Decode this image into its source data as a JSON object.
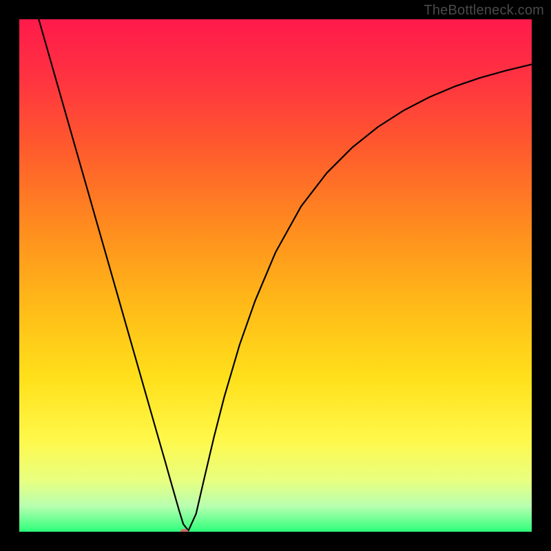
{
  "watermark": "TheBottleneck.com",
  "chart_data": {
    "type": "line",
    "title": "",
    "xlabel": "",
    "ylabel": "",
    "xlim": [
      0,
      100
    ],
    "ylim": [
      0,
      100
    ],
    "grid": false,
    "legend": false,
    "background_gradient_stops": [
      {
        "offset": 0.0,
        "color": "#ff1a4b"
      },
      {
        "offset": 0.12,
        "color": "#ff3440"
      },
      {
        "offset": 0.25,
        "color": "#ff5a2d"
      },
      {
        "offset": 0.4,
        "color": "#ff8a1f"
      },
      {
        "offset": 0.55,
        "color": "#ffb818"
      },
      {
        "offset": 0.7,
        "color": "#ffe01a"
      },
      {
        "offset": 0.82,
        "color": "#fff84a"
      },
      {
        "offset": 0.9,
        "color": "#e8ff80"
      },
      {
        "offset": 0.95,
        "color": "#b8ffb0"
      },
      {
        "offset": 1.0,
        "color": "#2dff7a"
      }
    ],
    "series": [
      {
        "name": "bottleneck-curve",
        "color": "#000000",
        "stroke_width": 2.2,
        "x": [
          3.8,
          5,
          7,
          9,
          11,
          13,
          15,
          17,
          19,
          21,
          23,
          25,
          27,
          28.5,
          29.2,
          29.8,
          30.2,
          30.6,
          31.2,
          32,
          33,
          34.5,
          36,
          38,
          40,
          43,
          46,
          50,
          55,
          60,
          65,
          70,
          75,
          80,
          85,
          90,
          95,
          100
        ],
        "y": [
          100,
          95.8,
          88.8,
          81.8,
          74.8,
          67.8,
          60.8,
          53.8,
          46.8,
          39.8,
          32.8,
          25.8,
          18.8,
          13.6,
          11.1,
          9.0,
          7.6,
          6.2,
          4.1,
          1.5,
          0.2,
          3.5,
          10.0,
          18.5,
          26.3,
          36.5,
          45.0,
          54.5,
          63.5,
          70.0,
          75.0,
          79.0,
          82.2,
          84.8,
          86.9,
          88.6,
          90.0,
          91.2
        ]
      }
    ],
    "marker": {
      "name": "optimal-point",
      "x": 32.2,
      "y": 0.0,
      "rx": 6,
      "ry": 4,
      "fill": "#d46a6a"
    }
  }
}
